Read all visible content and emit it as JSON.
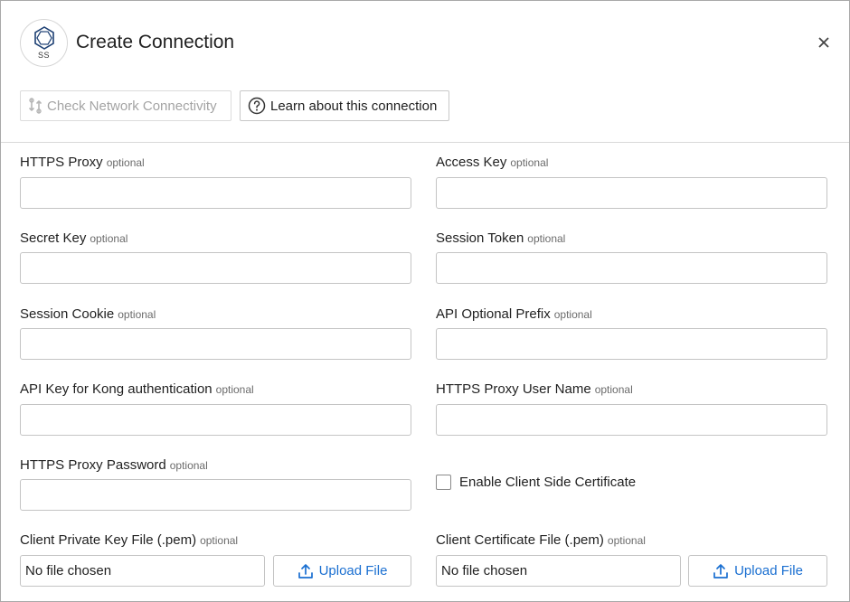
{
  "dialog": {
    "title": "Create Connection",
    "logo_text": "SS",
    "close_icon": "close-icon"
  },
  "toolbar": {
    "check_network_label": "Check Network Connectivity",
    "learn_label": "Learn about this connection"
  },
  "optional_text": "optional",
  "fields": {
    "https_proxy": {
      "label": "HTTPS Proxy",
      "value": ""
    },
    "access_key": {
      "label": "Access Key",
      "value": ""
    },
    "secret_key": {
      "label": "Secret Key",
      "value": ""
    },
    "session_token": {
      "label": "Session Token",
      "value": ""
    },
    "session_cookie": {
      "label": "Session Cookie",
      "value": ""
    },
    "api_prefix": {
      "label": "API Optional Prefix",
      "value": ""
    },
    "kong_key": {
      "label": "API Key for Kong authentication",
      "value": ""
    },
    "proxy_user": {
      "label": "HTTPS Proxy User Name",
      "value": ""
    },
    "proxy_password": {
      "label": "HTTPS Proxy Password",
      "value": ""
    }
  },
  "client_cert_checkbox": {
    "label": "Enable Client Side Certificate",
    "checked": false
  },
  "files": {
    "private_key": {
      "label": "Client Private Key File (.pem)",
      "status": "No file chosen",
      "button": "Upload File"
    },
    "certificate": {
      "label": "Client Certificate File (.pem)",
      "status": "No file chosen",
      "button": "Upload File"
    }
  },
  "colors": {
    "accent": "#1a6fd1",
    "logo_stroke": "#1c3f73",
    "disabled_text": "#a4a4a4"
  }
}
